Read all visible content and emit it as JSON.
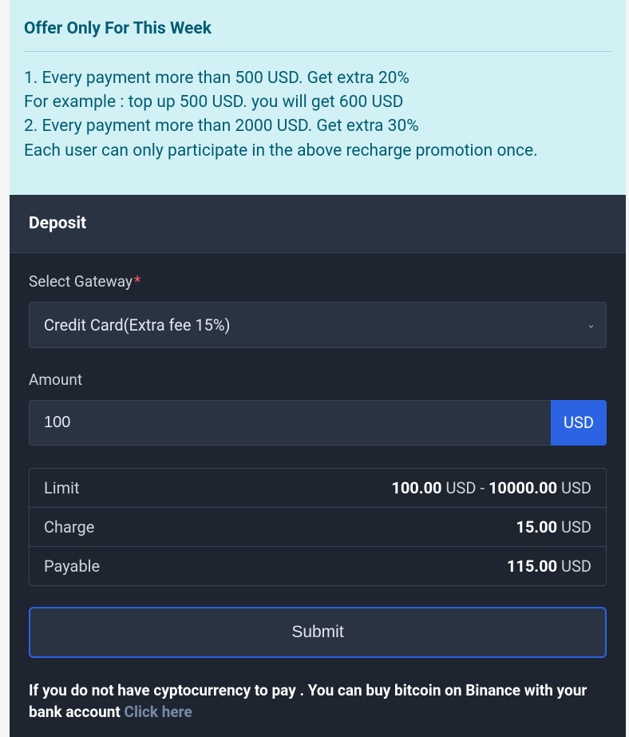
{
  "offer": {
    "title": "Offer Only For This Week",
    "line1": "1. Every payment more than 500 USD. Get extra 20%",
    "line2": "For example : top up 500 USD. you will get 600 USD",
    "line3": "2. Every payment more than 2000 USD. Get extra 30%",
    "line4": "Each user can only participate in the above recharge promotion once."
  },
  "deposit": {
    "heading": "Deposit",
    "gateway_label": "Select Gateway",
    "gateway_value": "Credit Card(Extra fee 15%)",
    "amount_label": "Amount",
    "amount_value": "100",
    "currency_addon": "USD"
  },
  "summary": {
    "limit_label": "Limit",
    "limit_min": "100.00",
    "limit_min_unit": "USD",
    "limit_sep": " - ",
    "limit_max": "10000.00",
    "limit_max_unit": "USD",
    "charge_label": "Charge",
    "charge_value": "15.00",
    "charge_unit": "USD",
    "payable_label": "Payable",
    "payable_value": "115.00",
    "payable_unit": "USD"
  },
  "submit_label": "Submit",
  "footer": {
    "text": "If you do not have cyptocurrency to pay . You can buy bitcoin on Binance with your bank account ",
    "link": "Click here"
  }
}
